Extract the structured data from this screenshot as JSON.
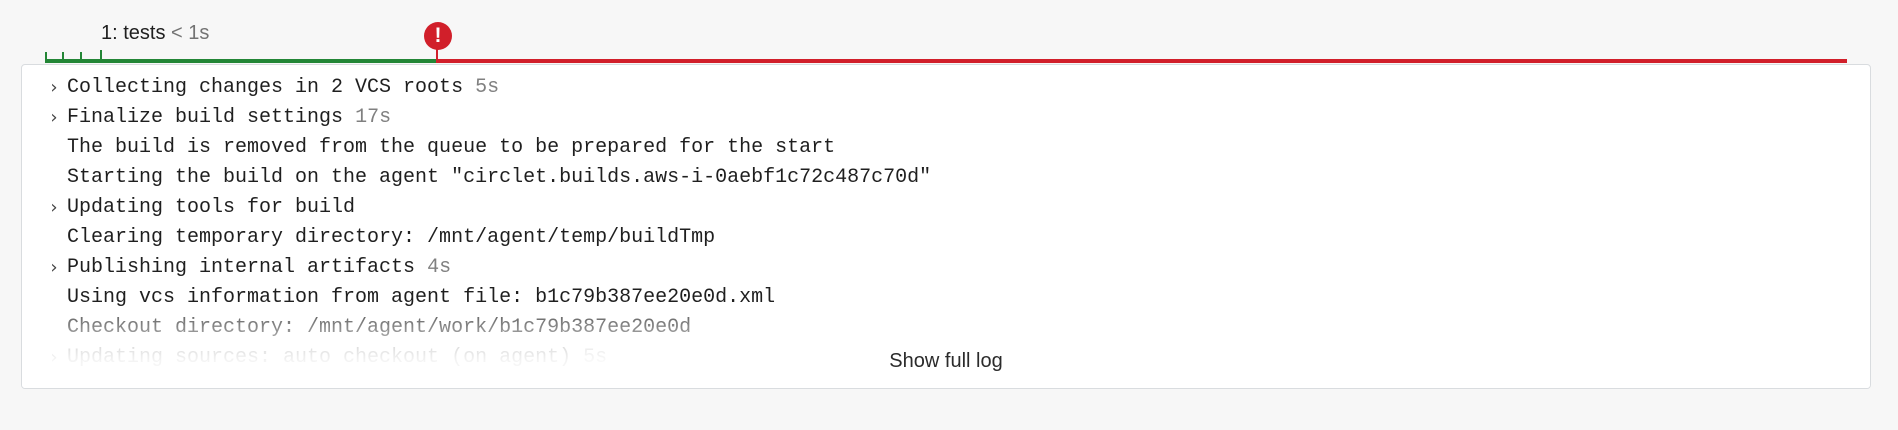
{
  "timeline": {
    "stage_name": "1: tests",
    "stage_duration": "< 1s",
    "error_icon": "exclamation-circle-icon",
    "colors": {
      "success": "#238636",
      "failure": "#d11f2a"
    }
  },
  "log": {
    "lines": [
      {
        "text": "Collecting changes in 2 VCS roots",
        "time": "5s",
        "expandable": true
      },
      {
        "text": "Finalize build settings",
        "time": "17s",
        "expandable": true
      },
      {
        "text": "The build is removed from the queue to be prepared for the start",
        "time": "",
        "expandable": false
      },
      {
        "text": "Starting the build on the agent \"circlet.builds.aws-i-0aebf1c72c487c70d\"",
        "time": "",
        "expandable": false
      },
      {
        "text": "Updating tools for build",
        "time": "",
        "expandable": true
      },
      {
        "text": "Clearing temporary directory: /mnt/agent/temp/buildTmp",
        "time": "",
        "expandable": false
      },
      {
        "text": "Publishing internal artifacts",
        "time": "4s",
        "expandable": true
      },
      {
        "text": "Using vcs information from agent file: b1c79b387ee20e0d.xml",
        "time": "",
        "expandable": false
      },
      {
        "text": "Checkout directory: /mnt/agent/work/b1c79b387ee20e0d",
        "time": "",
        "expandable": false
      },
      {
        "text": "Updating sources: auto checkout (on agent)",
        "time": "5s",
        "expandable": true
      }
    ],
    "expand_icon": "chevron-right-icon",
    "show_full_log_label": "Show full log"
  }
}
